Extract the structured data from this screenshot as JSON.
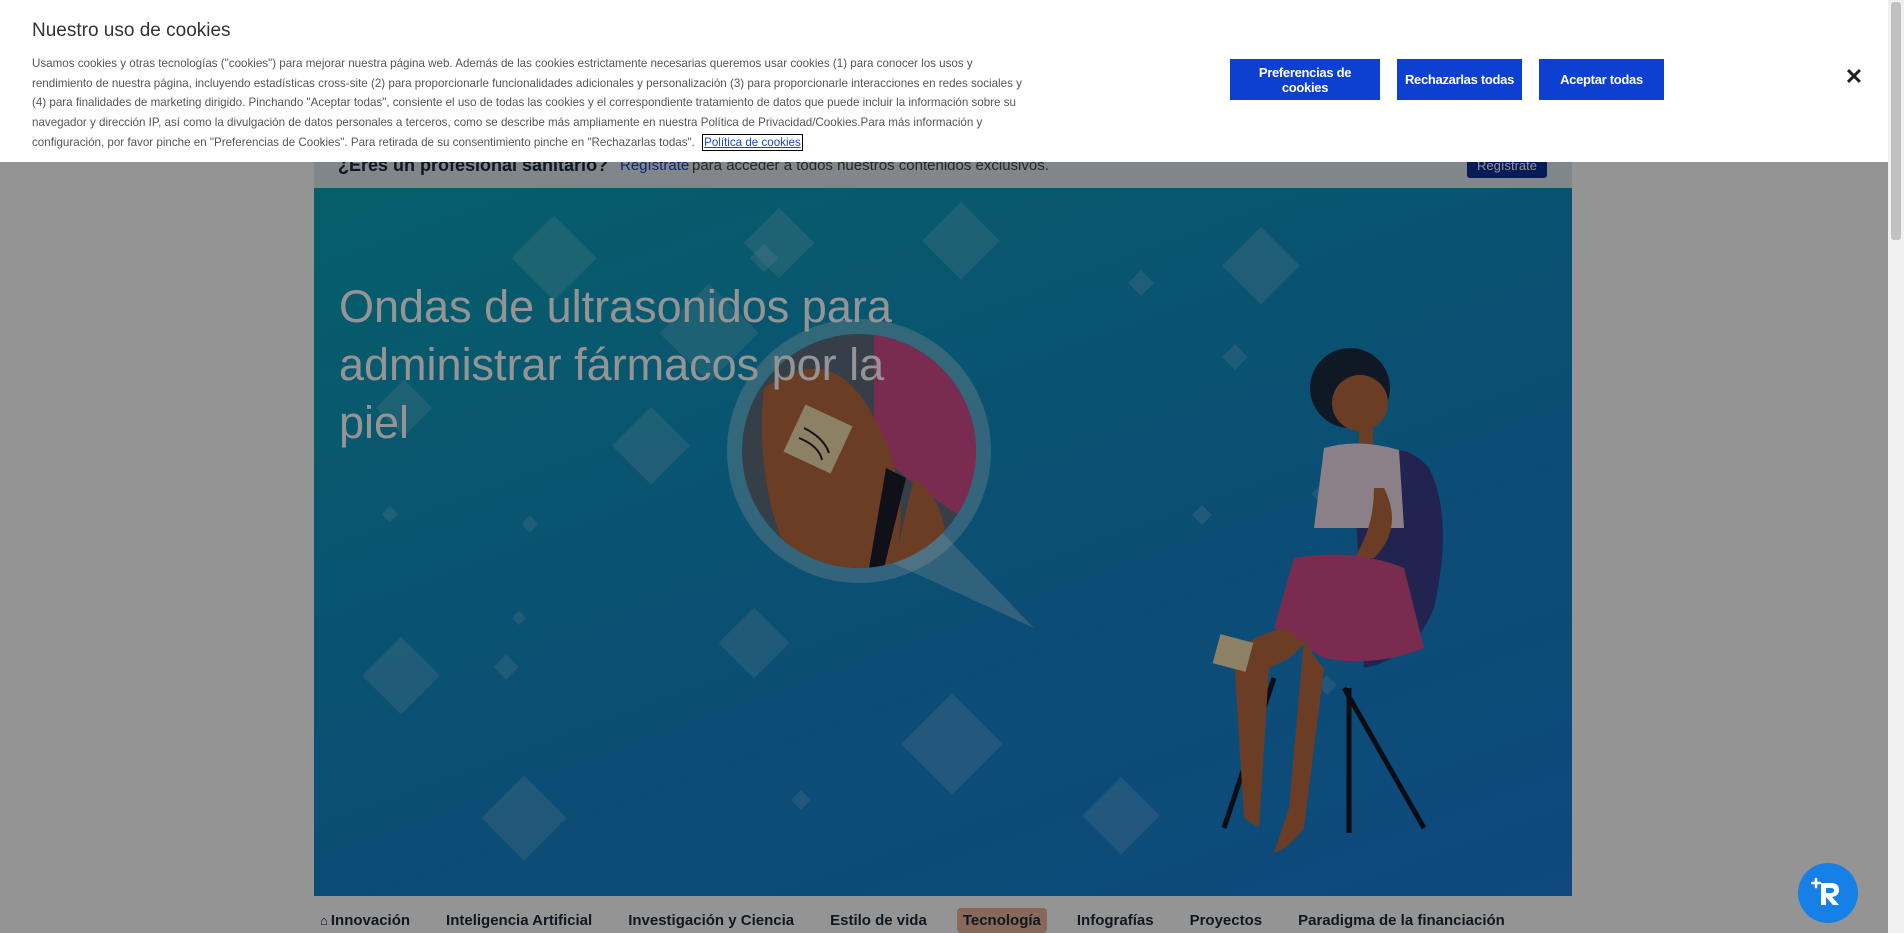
{
  "cookie_banner": {
    "title": "Nuestro uso de cookies",
    "text": "Usamos cookies y otras tecnologías (\"cookies\") para mejorar nuestra página web. Además de las cookies estrictamente necesarias queremos usar cookies (1) para conocer los usos y rendimiento de nuestra página, incluyendo estadísticas cross-site (2) para proporcionarle funcionalidades adicionales y personalización (3) para proporcionarle interacciones en redes sociales y (4) para finalidades de marketing dirigido. Pinchando \"Aceptar todas\", consiente el uso de todas las cookies y el correspondiente tratamiento de datos que puede incluir la información sobre su navegador y dirección IP, así como la divulgación de datos personales a terceros, como se describe más ampliamente en nuestra Política de Privacidad/Cookies.Para más información y configuración, por favor pinche en \"Preferencias de Cookies\". Para retirada de su consentimiento pinche en \"Rechazarlas todas\".",
    "policy_link": "Política de cookies",
    "btn_preferences": "Preferencias de cookies",
    "btn_reject": "Rechazarlas todas",
    "btn_accept": "Aceptar todas",
    "close_icon": "close-icon",
    "accent_color": "#0d3fd1"
  },
  "hcp_banner": {
    "title": "¿Eres un profesional sanitario?",
    "link": "Regístrate",
    "rest": "para acceder a todos nuestros contenidos exclusivos.",
    "button": "Regístrate"
  },
  "hero": {
    "title": "Ondas de ultrasonidos para administrar fármacos por la piel"
  },
  "categories": {
    "home_icon": "home-icon",
    "items": [
      {
        "label": "Innovación"
      },
      {
        "label": "Inteligencia Artificial"
      },
      {
        "label": "Investigación y Ciencia"
      },
      {
        "label": "Estilo de vida"
      },
      {
        "label": "Tecnología"
      },
      {
        "label": "Infografías"
      },
      {
        "label": "Proyectos"
      },
      {
        "label": "Paradigma de la financiación"
      }
    ],
    "active": "Tecnología"
  },
  "assistant": {
    "icon": "assistant-logo-icon"
  }
}
